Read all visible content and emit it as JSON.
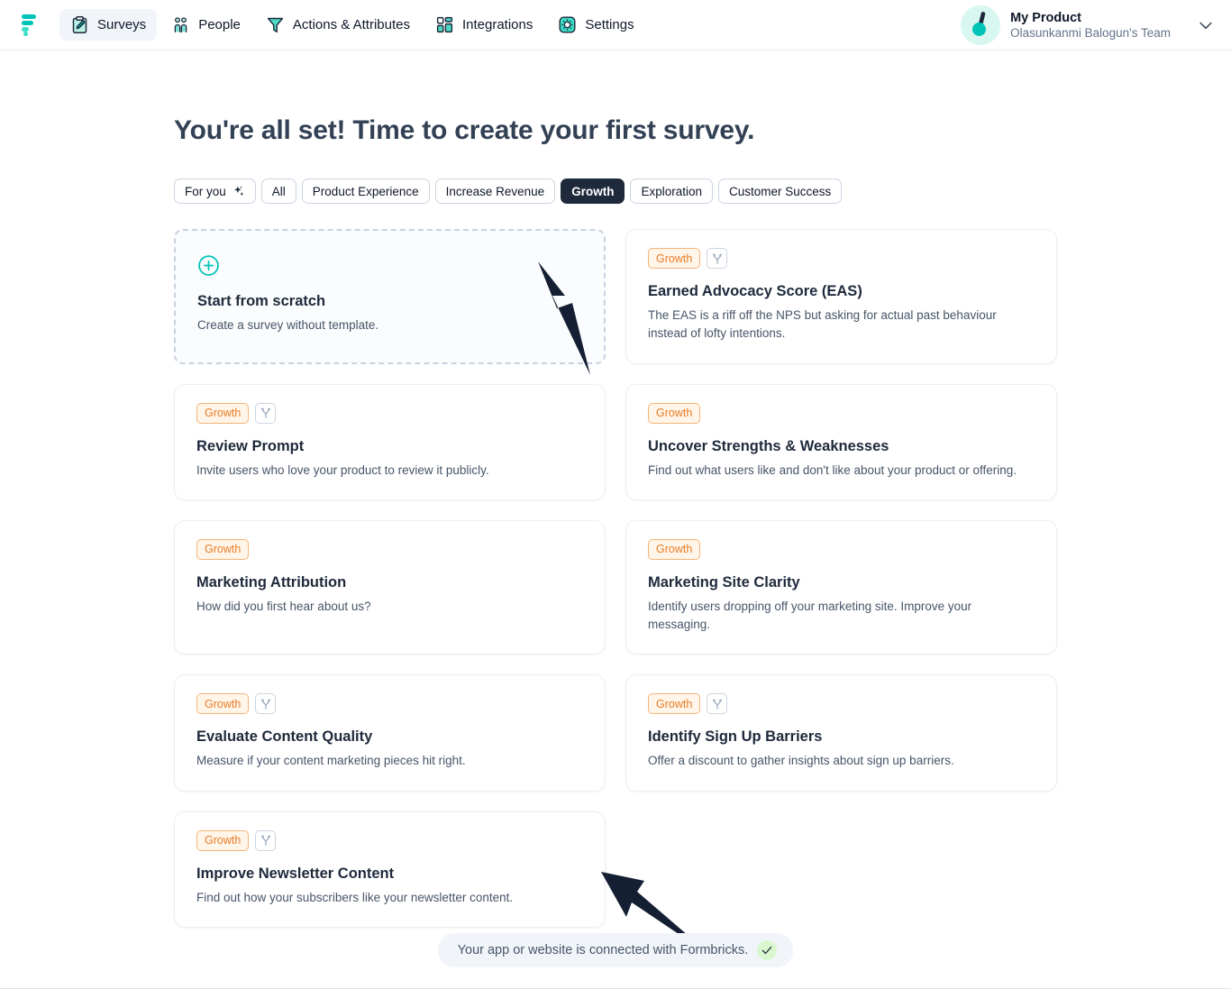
{
  "nav": {
    "logo_name": "formbricks-logo",
    "items": [
      {
        "label": "Surveys",
        "icon": "clipboard-edit-icon",
        "active": true
      },
      {
        "label": "People",
        "icon": "people-icon",
        "active": false
      },
      {
        "label": "Actions & Attributes",
        "icon": "funnel-icon",
        "active": false
      },
      {
        "label": "Integrations",
        "icon": "grid-blocks-icon",
        "active": false
      },
      {
        "label": "Settings",
        "icon": "gear-icon",
        "active": false
      }
    ],
    "account": {
      "product": "My Product",
      "team": "Olasunkanmi Balogun's Team",
      "avatar_icon": "product-avatar-icon",
      "chevron_icon": "chevron-down-icon"
    }
  },
  "main": {
    "title": "You're all set! Time to create your first survey.",
    "filters": [
      {
        "label": "For you",
        "selected": false,
        "icon": "sparkle-icon"
      },
      {
        "label": "All",
        "selected": false
      },
      {
        "label": "Product Experience",
        "selected": false
      },
      {
        "label": "Increase Revenue",
        "selected": false
      },
      {
        "label": "Growth",
        "selected": true
      },
      {
        "label": "Exploration",
        "selected": false
      },
      {
        "label": "Customer Success",
        "selected": false
      }
    ],
    "scratch_card": {
      "icon": "plus-circle-icon",
      "title": "Start from scratch",
      "description": "Create a survey without template."
    },
    "templates": [
      {
        "badge": "Growth",
        "has_branch_icon": true,
        "title": "Earned Advocacy Score (EAS)",
        "description": "The EAS is a riff off the NPS but asking for actual past behaviour instead of lofty intentions."
      },
      {
        "badge": "Growth",
        "has_branch_icon": true,
        "title": "Review Prompt",
        "description": "Invite users who love your product to review it publicly."
      },
      {
        "badge": "Growth",
        "has_branch_icon": false,
        "title": "Uncover Strengths & Weaknesses",
        "description": "Find out what users like and don't like about your product or offering."
      },
      {
        "badge": "Growth",
        "has_branch_icon": false,
        "title": "Marketing Attribution",
        "description": "How did you first hear about us?"
      },
      {
        "badge": "Growth",
        "has_branch_icon": false,
        "title": "Marketing Site Clarity",
        "description": "Identify users dropping off your marketing site. Improve your messaging."
      },
      {
        "badge": "Growth",
        "has_branch_icon": true,
        "title": "Evaluate Content Quality",
        "description": "Measure if your content marketing pieces hit right."
      },
      {
        "badge": "Growth",
        "has_branch_icon": true,
        "title": "Identify Sign Up Barriers",
        "description": "Offer a discount to gather insights about sign up barriers."
      },
      {
        "badge": "Growth",
        "has_branch_icon": true,
        "title": "Improve Newsletter Content",
        "description": "Find out how your subscribers like your newsletter content."
      }
    ]
  },
  "footer": {
    "status_text": "Your app or website is connected with Formbricks.",
    "status_icon": "check-icon"
  },
  "annotations": [
    {
      "name": "arrow-pointing-to-growth-filter",
      "direction": "up-left"
    },
    {
      "name": "arrow-pointing-to-newsletter-card",
      "direction": "up-left"
    }
  ],
  "colors": {
    "accent_teal": "#00c4b8",
    "badge_orange": "#ea7c25",
    "selected_chip": "#1e293b",
    "title": "#334155"
  }
}
